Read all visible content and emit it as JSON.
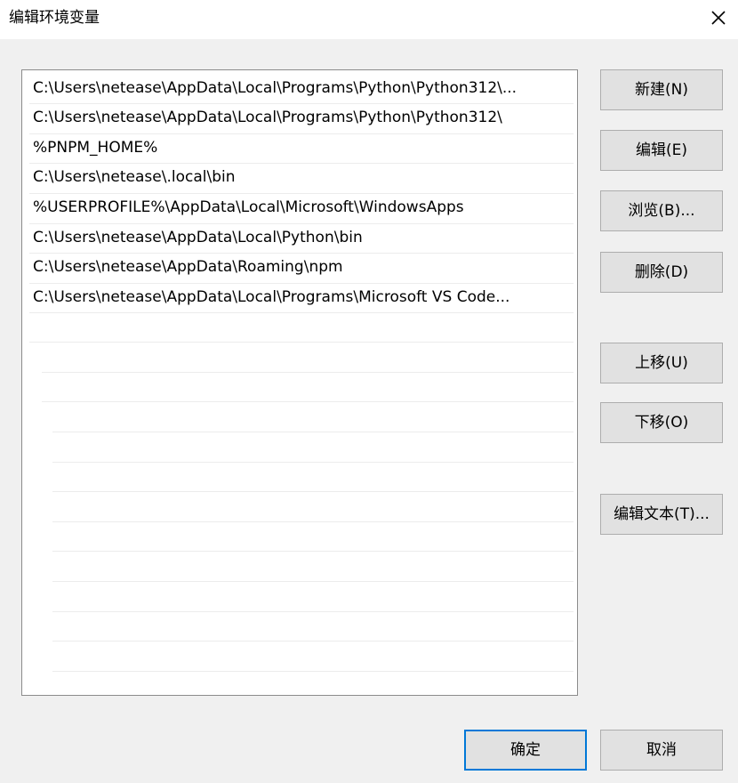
{
  "window": {
    "title": "编辑环境变量"
  },
  "paths": [
    "C:\\Users\\netease\\AppData\\Local\\Programs\\Python\\Python312\\...",
    "C:\\Users\\netease\\AppData\\Local\\Programs\\Python\\Python312\\",
    "%PNPM_HOME%",
    "C:\\Users\\netease\\.local\\bin",
    "%USERPROFILE%\\AppData\\Local\\Microsoft\\WindowsApps",
    "C:\\Users\\netease\\AppData\\Local\\Python\\bin",
    "C:\\Users\\netease\\AppData\\Roaming\\npm",
    "C:\\Users\\netease\\AppData\\Local\\Programs\\Microsoft VS Code..."
  ],
  "buttons": {
    "new": "新建(N)",
    "edit": "编辑(E)",
    "browse": "浏览(B)...",
    "delete": "删除(D)",
    "move_up": "上移(U)",
    "move_down": "下移(O)",
    "edit_text": "编辑文本(T)...",
    "ok": "确定",
    "cancel": "取消"
  },
  "colors": {
    "default_button_border": "#0078d7",
    "button_face": "#e1e1e1",
    "dialog_background": "#f0f0f0"
  },
  "icons": {
    "close": "close-icon"
  }
}
